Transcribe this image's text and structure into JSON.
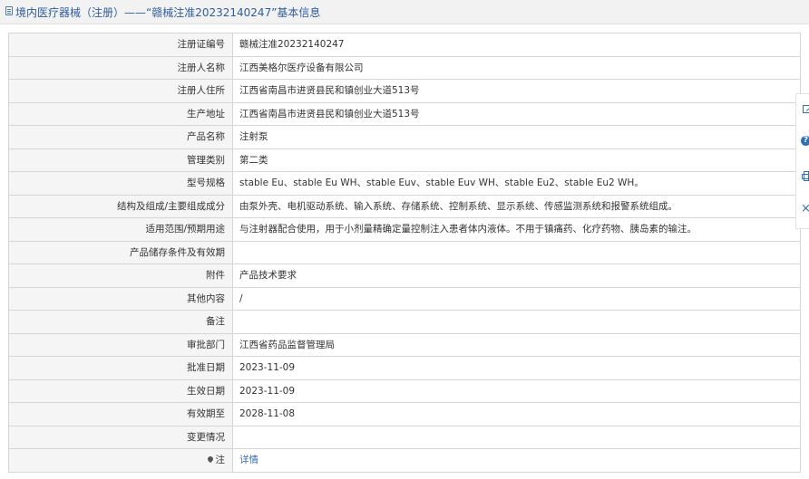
{
  "header": {
    "title": "境内医疗器械（注册）——“赣械注准20232140247”基本信息"
  },
  "rows": [
    {
      "label": "注册证编号",
      "value": "赣械注准20232140247"
    },
    {
      "label": "注册人名称",
      "value": "江西美格尔医疗设备有限公司"
    },
    {
      "label": "注册人住所",
      "value": "江西省南昌市进贤县民和镇创业大道513号"
    },
    {
      "label": "生产地址",
      "value": "江西省南昌市进贤县民和镇创业大道513号"
    },
    {
      "label": "产品名称",
      "value": "注射泵"
    },
    {
      "label": "管理类别",
      "value": "第二类"
    },
    {
      "label": "型号规格",
      "value": "stable Eu、stable Eu WH、stable Euv、stable Euv WH、stable Eu2、stable Eu2 WH。"
    },
    {
      "label": "结构及组成/主要组成成分",
      "value": "由泵外壳、电机驱动系统、输入系统、存储系统、控制系统、显示系统、传感监测系统和报警系统组成。"
    },
    {
      "label": "适用范围/预期用途",
      "value": "与注射器配合使用，用于小剂量精确定量控制注入患者体内液体。不用于镇痛药、化疗药物、胰岛素的输注。"
    },
    {
      "label": "产品储存条件及有效期",
      "value": ""
    },
    {
      "label": "附件",
      "value": "产品技术要求"
    },
    {
      "label": "其他内容",
      "value": "/"
    },
    {
      "label": "备注",
      "value": ""
    },
    {
      "label": "审批部门",
      "value": "江西省药品监督管理局"
    },
    {
      "label": "批准日期",
      "value": "2023-11-09"
    },
    {
      "label": "生效日期",
      "value": "2023-11-09"
    },
    {
      "label": "有效期至",
      "value": "2028-11-08"
    },
    {
      "label": "变更情况",
      "value": ""
    }
  ],
  "note_row": {
    "label": "注",
    "link": "详情"
  },
  "sidebar": {
    "help_glyph": "?",
    "close_glyph": "×",
    "icons": [
      "edit-icon",
      "help-icon",
      "print-icon",
      "close-icon"
    ]
  },
  "colors": {
    "title": "#2f5d9c",
    "link": "#3a6fb0",
    "label_bg": "#f5f5f5",
    "border": "#d6d6d6"
  }
}
